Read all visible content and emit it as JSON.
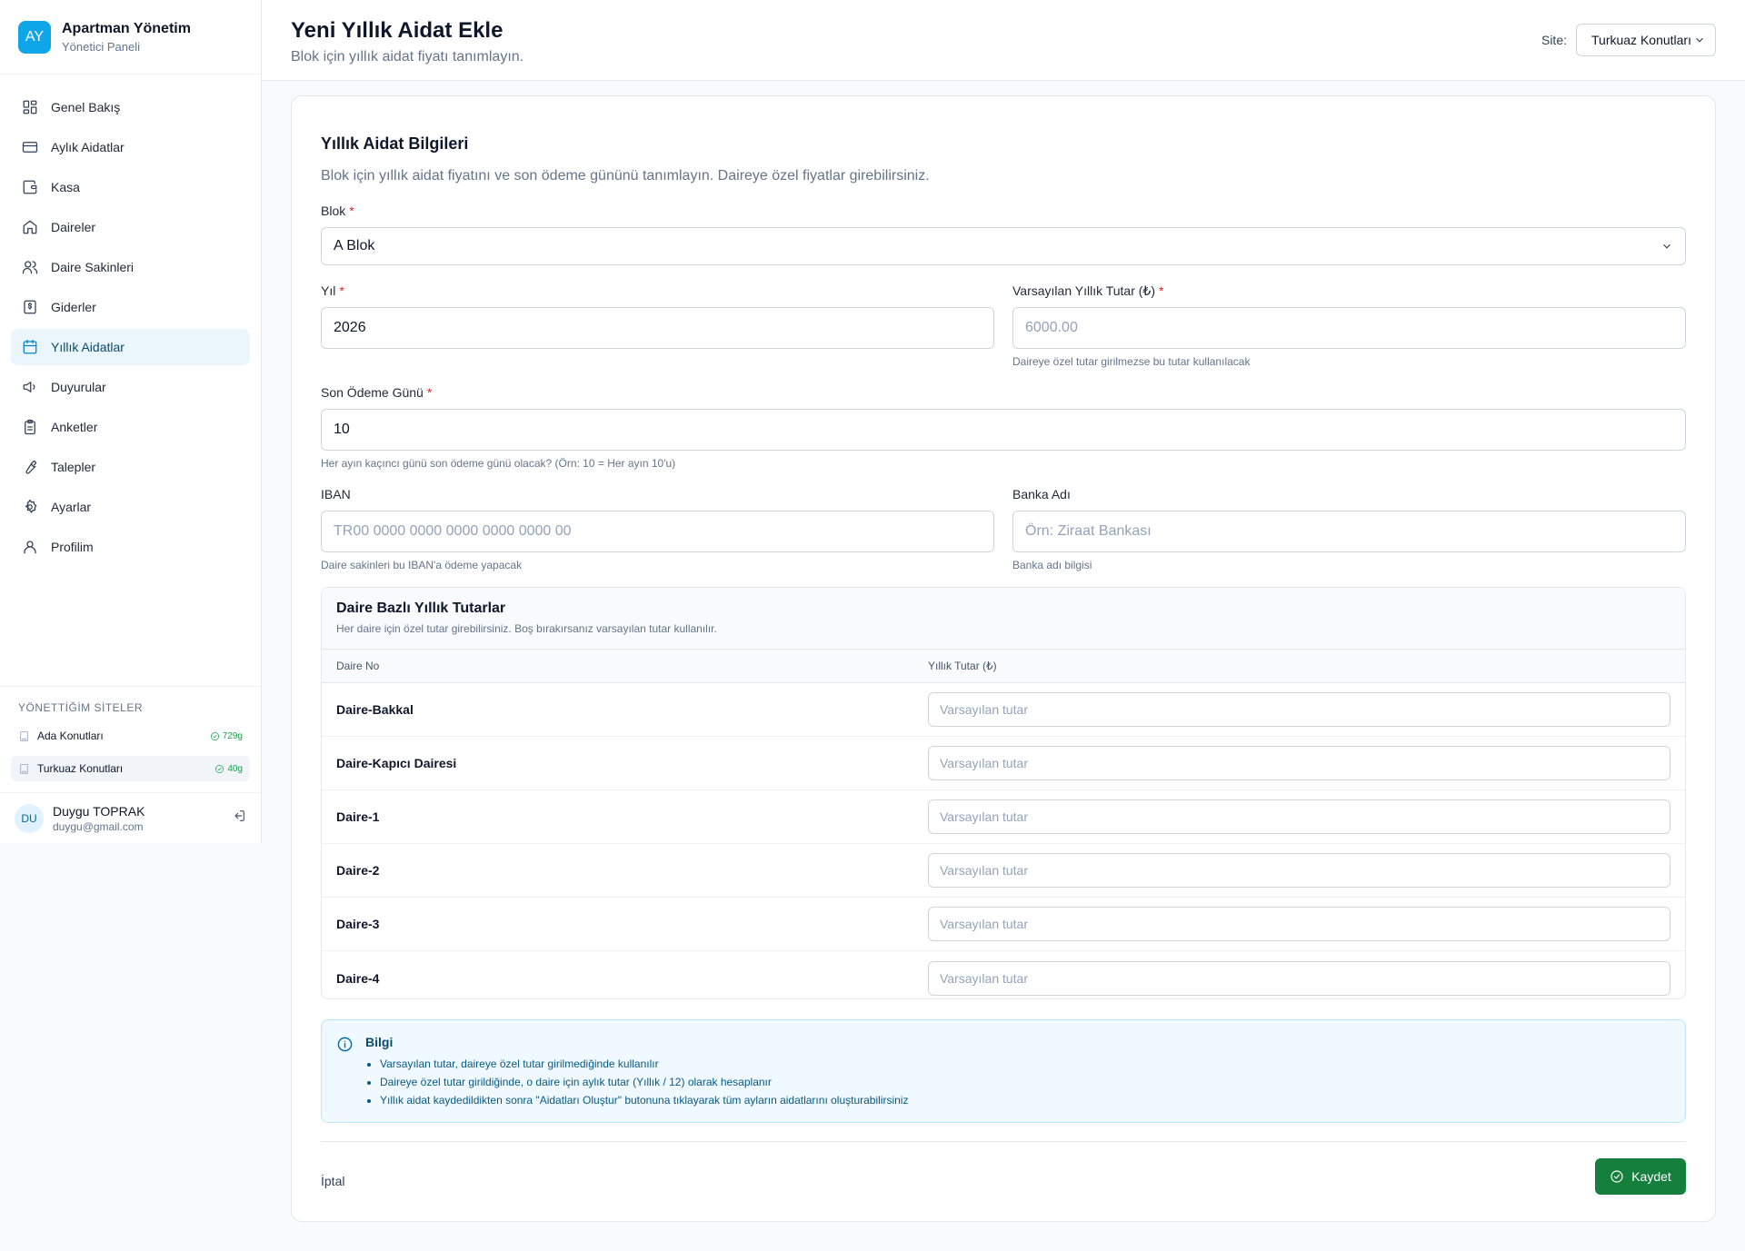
{
  "brand": {
    "logo": "AY",
    "title": "Apartman Yönetim",
    "subtitle": "Yönetici Paneli"
  },
  "nav": [
    {
      "label": "Genel Bakış",
      "icon": "dashboard-icon",
      "active": false
    },
    {
      "label": "Aylık Aidatlar",
      "icon": "credit-card-icon",
      "active": false
    },
    {
      "label": "Kasa",
      "icon": "wallet-icon",
      "active": false
    },
    {
      "label": "Daireler",
      "icon": "home-icon",
      "active": false
    },
    {
      "label": "Daire Sakinleri",
      "icon": "users-icon",
      "active": false
    },
    {
      "label": "Giderler",
      "icon": "receipt-icon",
      "active": false
    },
    {
      "label": "Yıllık Aidatlar",
      "icon": "calendar-icon",
      "active": true
    },
    {
      "label": "Duyurular",
      "icon": "megaphone-icon",
      "active": false
    },
    {
      "label": "Anketler",
      "icon": "clipboard-icon",
      "active": false
    },
    {
      "label": "Talepler",
      "icon": "wrench-icon",
      "active": false
    },
    {
      "label": "Ayarlar",
      "icon": "gear-icon",
      "active": false
    },
    {
      "label": "Profilim",
      "icon": "user-icon",
      "active": false
    }
  ],
  "sites": {
    "title": "YÖNETTİĞİM SİTELER",
    "items": [
      {
        "name": "Ada Konutları",
        "badge": "729g",
        "active": false
      },
      {
        "name": "Turkuaz Konutları",
        "badge": "40g",
        "active": true
      }
    ]
  },
  "user": {
    "initials": "DU",
    "name": "Duygu TOPRAK",
    "email": "duygu@gmail.com"
  },
  "header": {
    "title": "Yeni Yıllık Aidat Ekle",
    "subtitle": "Blok için yıllık aidat fiyatı tanımlayın.",
    "site_label": "Site:",
    "site_value": "Turkuaz Konutları"
  },
  "form": {
    "title": "Yıllık Aidat Bilgileri",
    "description": "Blok için yıllık aidat fiyatını ve son ödeme gününü tanımlayın. Daireye özel fiyatlar girebilirsiniz.",
    "block": {
      "label": "Blok",
      "value": "A Blok"
    },
    "year": {
      "label": "Yıl",
      "value": "2026"
    },
    "default_amount": {
      "label": "Varsayılan Yıllık Tutar (₺)",
      "placeholder": "6000.00",
      "hint": "Daireye özel tutar girilmezse bu tutar kullanılacak"
    },
    "due_day": {
      "label": "Son Ödeme Günü",
      "value": "10",
      "hint": "Her ayın kaçıncı günü son ödeme günü olacak? (Örn: 10 = Her ayın 10'u)"
    },
    "iban": {
      "label": "IBAN",
      "placeholder": "TR00 0000 0000 0000 0000 0000 00",
      "hint": "Daire sakinleri bu IBAN'a ödeme yapacak"
    },
    "bank": {
      "label": "Banka Adı",
      "placeholder": "Örn: Ziraat Bankası",
      "hint": "Banka adı bilgisi"
    },
    "required_mark": "*"
  },
  "apartments": {
    "title": "Daire Bazlı Yıllık Tutarlar",
    "description": "Her daire için özel tutar girebilirsiniz. Boş bırakırsanız varsayılan tutar kullanılır.",
    "col_no": "Daire No",
    "col_amount": "Yıllık Tutar (₺)",
    "placeholder": "Varsayılan tutar",
    "rows": [
      "Daire-Bakkal",
      "Daire-Kapıcı Dairesi",
      "Daire-1",
      "Daire-2",
      "Daire-3",
      "Daire-4"
    ]
  },
  "info": {
    "title": "Bilgi",
    "items": [
      "Varsayılan tutar, daireye özel tutar girilmediğinde kullanılır",
      "Daireye özel tutar girildiğinde, o daire için aylık tutar (Yıllık / 12) olarak hesaplanır",
      "Yıllık aidat kaydedildikten sonra \"Aidatları Oluştur\" butonuna tıklayarak tüm ayların aidatlarını oluşturabilirsiniz"
    ]
  },
  "footer": {
    "cancel": "İptal",
    "save": "Kaydet"
  },
  "colors": {
    "accent": "#0ea5e9",
    "save": "#15803d",
    "active_bg": "#eaf5fc",
    "required": "#dc2626"
  }
}
